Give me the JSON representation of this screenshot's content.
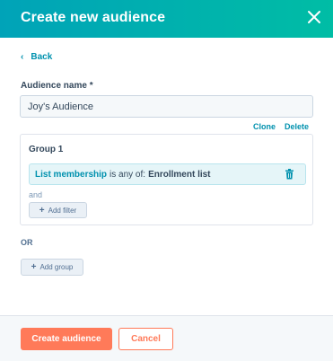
{
  "header": {
    "title": "Create new audience",
    "close_icon": "close-icon"
  },
  "back": {
    "label": "Back",
    "icon": "chevron-left-icon"
  },
  "audience_name": {
    "label": "Audience name *",
    "value": "Joy's Audience"
  },
  "group_actions": {
    "clone_label": "Clone",
    "delete_label": "Delete"
  },
  "group": {
    "title": "Group 1",
    "filter": {
      "property": "List membership",
      "operator": "is any of:",
      "value": "Enrollment list",
      "delete_icon": "trash-icon"
    },
    "and_label": "and",
    "add_filter_label": "Add filter"
  },
  "or_label": "OR",
  "add_group_label": "Add group",
  "footer": {
    "create_label": "Create audience",
    "cancel_label": "Cancel"
  },
  "colors": {
    "header_gradient_start": "#00a3b8",
    "header_gradient_end": "#00bda5",
    "link": "#0091ae",
    "primary_button": "#ff7a59",
    "filter_row_bg": "#e5f5f8"
  }
}
